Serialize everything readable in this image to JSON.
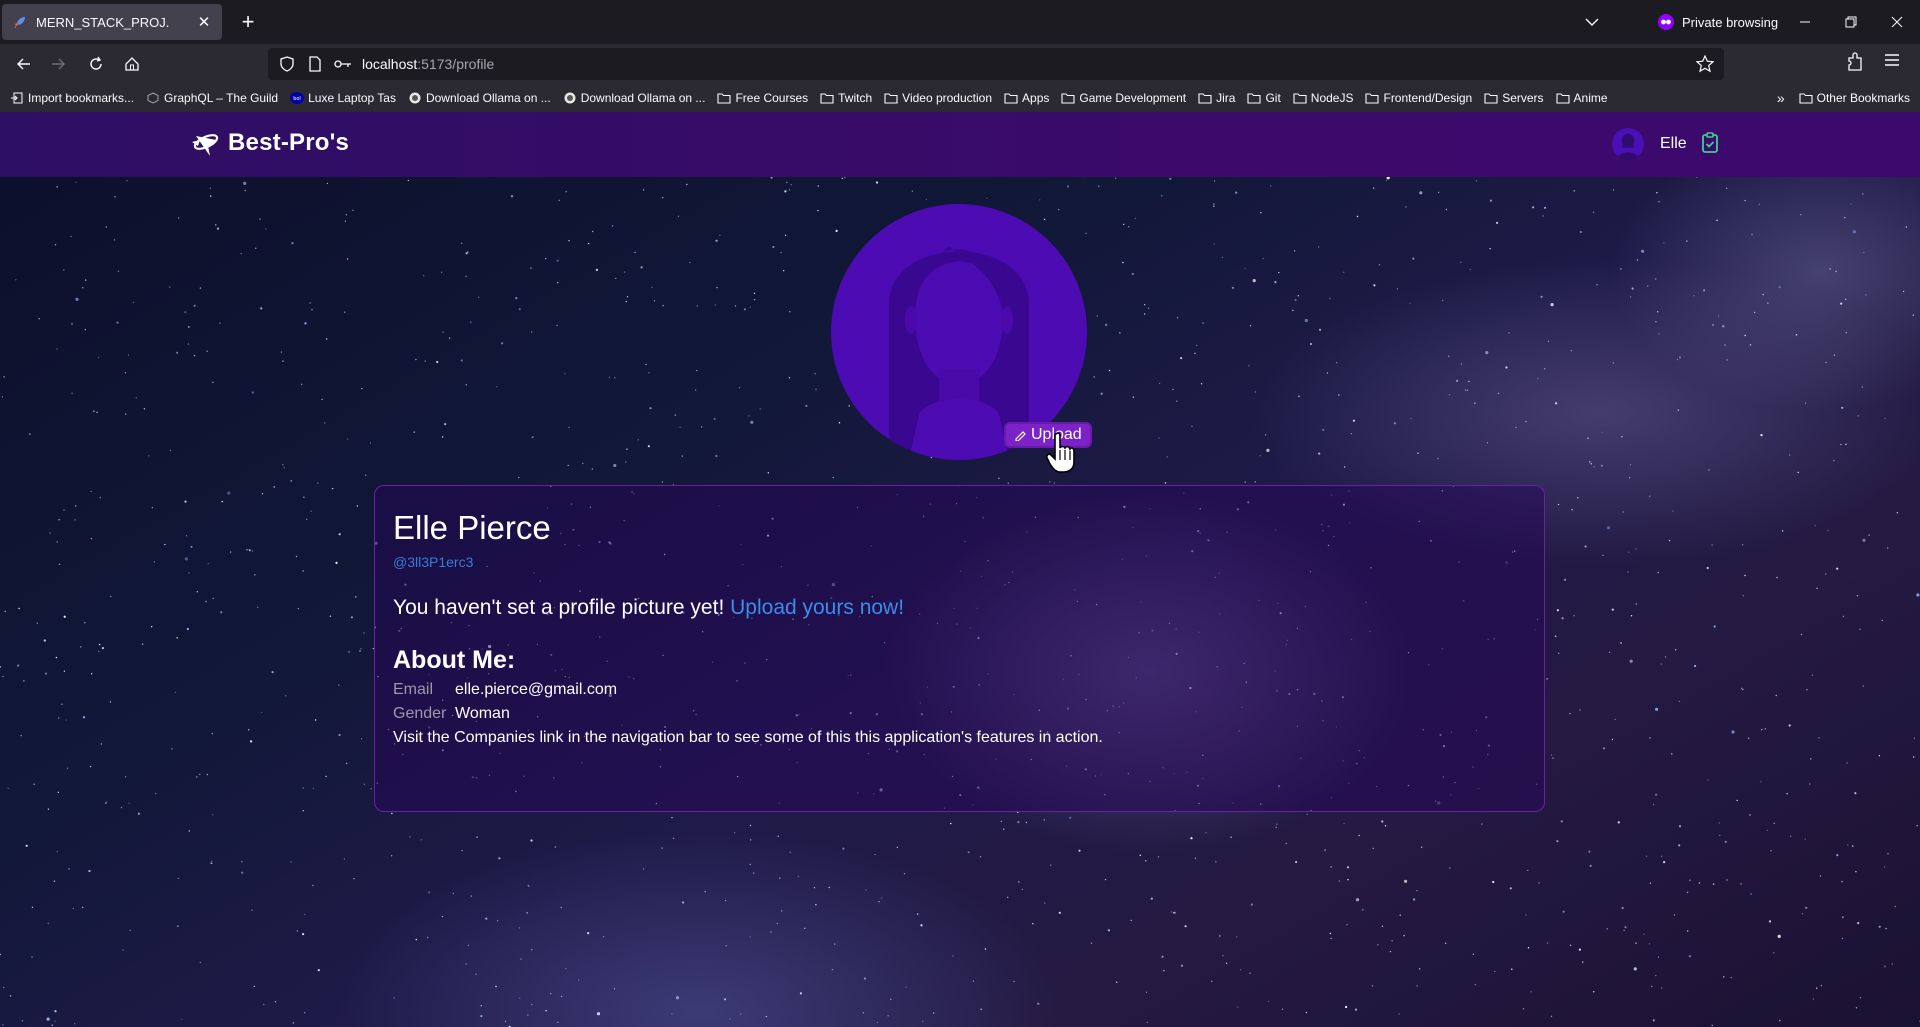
{
  "browser": {
    "tab_title": "MERN_STACK_PROJ.",
    "private_label": "Private browsing",
    "url_host": "localhost",
    "url_rest": ":5173/profile",
    "bookmarks": [
      {
        "label": "Import bookmarks...",
        "icon": "import-icon"
      },
      {
        "label": "GraphQL – The Guild",
        "icon": "graphql-icon"
      },
      {
        "label": "Luxe Laptop Tas",
        "icon": "bol-icon"
      },
      {
        "label": "Download Ollama on ...",
        "icon": "ollama-icon"
      },
      {
        "label": "Download Ollama on ...",
        "icon": "ollama-icon"
      },
      {
        "label": "Free Courses",
        "icon": "folder-icon"
      },
      {
        "label": "Twitch",
        "icon": "folder-icon"
      },
      {
        "label": "Video production",
        "icon": "folder-icon"
      },
      {
        "label": "Apps",
        "icon": "folder-icon"
      },
      {
        "label": "Game Development",
        "icon": "folder-icon"
      },
      {
        "label": "Jira",
        "icon": "folder-icon"
      },
      {
        "label": "Git",
        "icon": "folder-icon"
      },
      {
        "label": "NodeJS",
        "icon": "folder-icon"
      },
      {
        "label": "Frontend/Design",
        "icon": "folder-icon"
      },
      {
        "label": "Servers",
        "icon": "folder-icon"
      },
      {
        "label": "Anime",
        "icon": "folder-icon"
      }
    ],
    "other_bookmarks": "Other Bookmarks"
  },
  "app": {
    "brand": "Best-Pro's",
    "user_name": "Elle",
    "upload_button": "Upload",
    "profile": {
      "full_name": "Elle Pierce",
      "handle": "@3ll3P1erc3",
      "no_picture_msg": "You haven't set a profile picture yet!",
      "upload_link": "Upload yours now!",
      "about_heading": "About Me:",
      "email_label": "Email",
      "email": "elle.pierce@gmail.com",
      "gender_label": "Gender",
      "gender": "Woman",
      "visit_msg": "Visit the Companies link in the navigation bar to see some of this this application's features in action."
    }
  },
  "colors": {
    "header_bg": "#3b0a6b",
    "avatar_bg": "#4d0bb3",
    "upload_btn": "#7b22c9",
    "link": "#3d8ce8",
    "clipboard_icon": "#3ecf8e"
  }
}
